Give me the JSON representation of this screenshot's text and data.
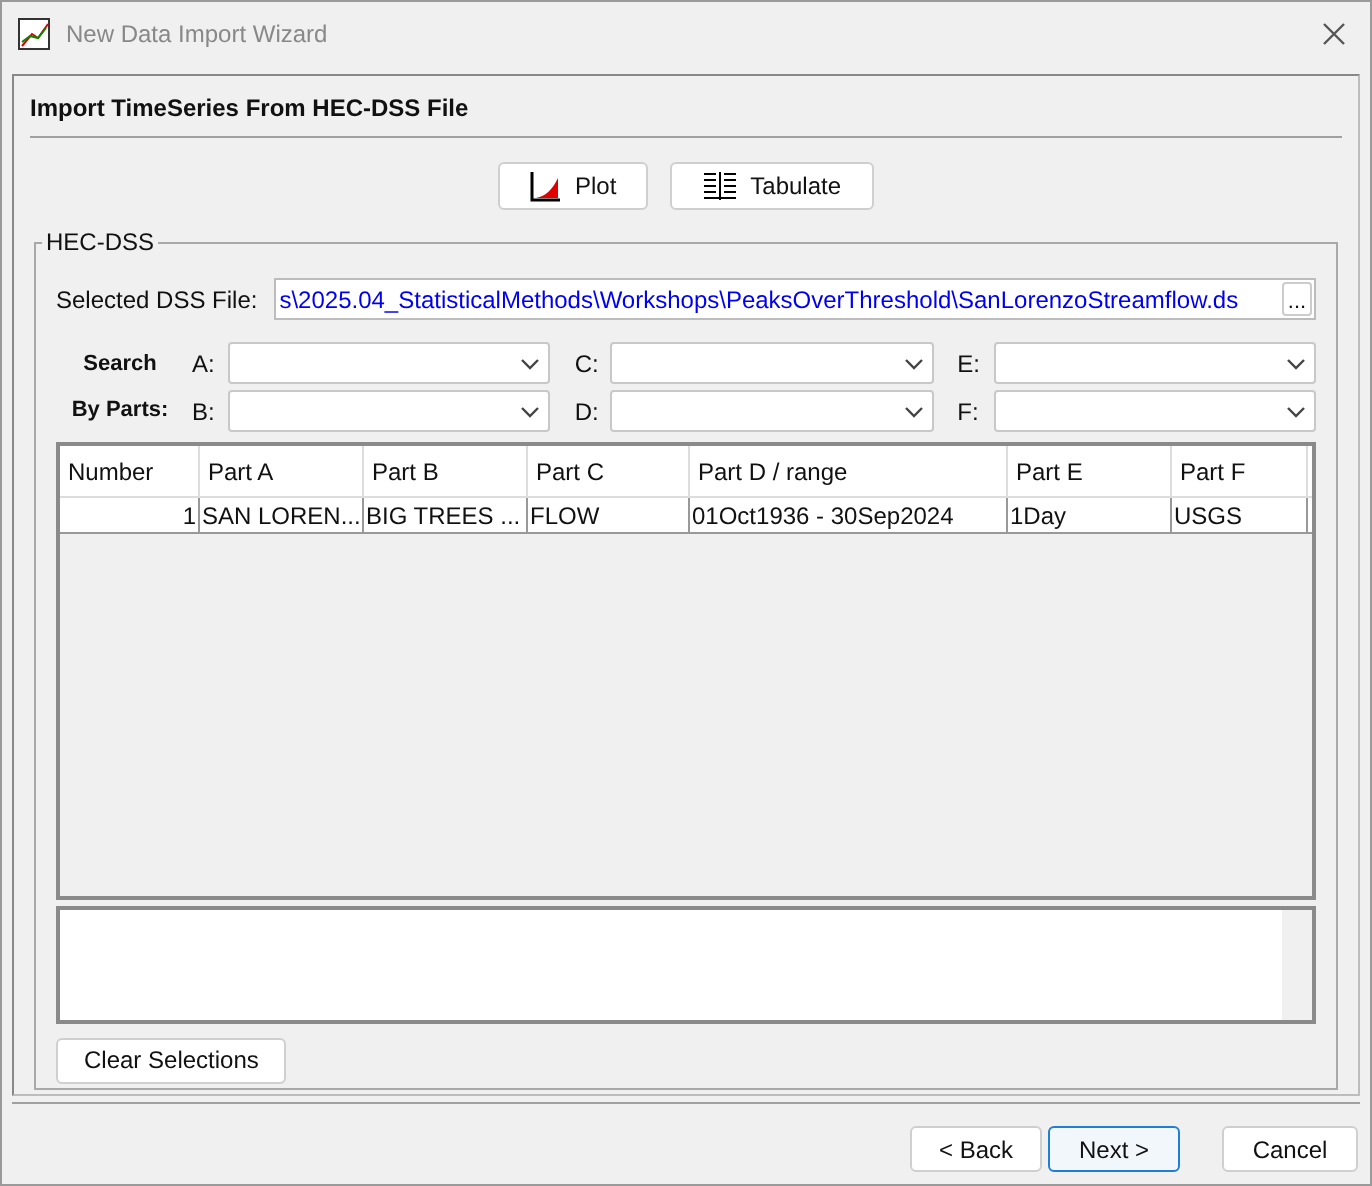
{
  "window": {
    "title": "New Data Import Wizard"
  },
  "header": "Import TimeSeries From HEC-DSS File",
  "toolbar": [
    {
      "kind": "plot",
      "label": "Plot"
    },
    {
      "kind": "tabulate",
      "label": "Tabulate"
    }
  ],
  "group": {
    "title": "HEC-DSS",
    "file_label": "Selected DSS File:",
    "file_value": "s\\2025.04_StatisticalMethods\\Workshops\\PeaksOverThreshold\\SanLorenzoStreamflow.ds",
    "browse": "...",
    "search_label": [
      "Search",
      "By Parts:"
    ],
    "parts": [
      {
        "label": "A:"
      },
      {
        "label": "C:"
      },
      {
        "label": "E:"
      },
      {
        "label": "B:"
      },
      {
        "label": "D:"
      },
      {
        "label": "F:"
      }
    ]
  },
  "table": {
    "columns": [
      "Number",
      "Part A",
      "Part B",
      "Part C",
      "Part D / range",
      "Part E",
      "Part F"
    ],
    "rows": [
      [
        "1",
        "SAN LOREN...",
        "BIG TREES ...",
        "FLOW",
        "01Oct1936 - 30Sep2024",
        "1Day",
        "USGS"
      ]
    ]
  },
  "clear_button": "Clear Selections",
  "buttons": [
    {
      "label": "< Back",
      "focused": false
    },
    {
      "label": "Next >",
      "focused": true
    },
    {
      "label": "Cancel",
      "focused": false
    }
  ]
}
